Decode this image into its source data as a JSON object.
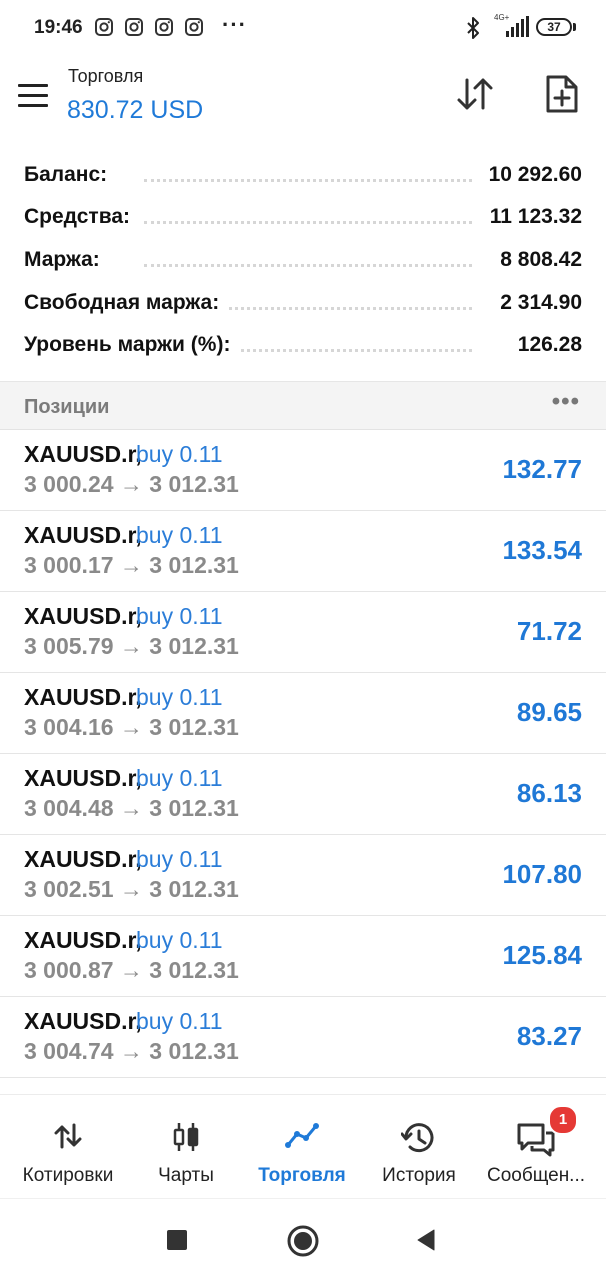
{
  "status_bar": {
    "time": "19:46",
    "notification_icons": [
      "instagram-icon",
      "instagram-icon",
      "instagram-icon",
      "instagram-icon"
    ],
    "more": "···",
    "network": "4G+",
    "battery": "37"
  },
  "header": {
    "title": "Торговля",
    "balance": "830.72 USD",
    "accent_color": "#1f7ad8"
  },
  "summary": [
    {
      "label": "Баланс:",
      "value": "10 292.60"
    },
    {
      "label": "Средства:",
      "value": "11 123.32"
    },
    {
      "label": "Маржа:",
      "value": "8 808.42"
    },
    {
      "label": "Свободная маржа:",
      "value": "2 314.90"
    },
    {
      "label": "Уровень маржи (%):",
      "value": "126.28"
    }
  ],
  "positions": {
    "title": "Позиции",
    "more": "•••",
    "items": [
      {
        "symbol": "XAUUSD.r,",
        "side": "buy 0.11",
        "prices": "3 000.24 → 3 012.31",
        "profit": "132.77"
      },
      {
        "symbol": "XAUUSD.r,",
        "side": "buy 0.11",
        "prices": "3 000.17 → 3 012.31",
        "profit": "133.54"
      },
      {
        "symbol": "XAUUSD.r,",
        "side": "buy 0.11",
        "prices": "3 005.79 → 3 012.31",
        "profit": "71.72"
      },
      {
        "symbol": "XAUUSD.r,",
        "side": "buy 0.11",
        "prices": "3 004.16 → 3 012.31",
        "profit": "89.65"
      },
      {
        "symbol": "XAUUSD.r,",
        "side": "buy 0.11",
        "prices": "3 004.48 → 3 012.31",
        "profit": "86.13"
      },
      {
        "symbol": "XAUUSD.r,",
        "side": "buy 0.11",
        "prices": "3 002.51 → 3 012.31",
        "profit": "107.80"
      },
      {
        "symbol": "XAUUSD.r,",
        "side": "buy 0.11",
        "prices": "3 000.87 → 3 012.31",
        "profit": "125.84"
      },
      {
        "symbol": "XAUUSD.r,",
        "side": "buy 0.11",
        "prices": "3 004.74 → 3 012.31",
        "profit": "83.27"
      }
    ]
  },
  "bottom_nav": {
    "items": [
      {
        "label": "Котировки",
        "icon": "quotes-icon"
      },
      {
        "label": "Чарты",
        "icon": "candlestick-chart-icon"
      },
      {
        "label": "Торговля",
        "icon": "trade-line-icon",
        "active": true
      },
      {
        "label": "История",
        "icon": "history-icon"
      },
      {
        "label": "Сообщен...",
        "icon": "messages-icon",
        "badge": "1"
      }
    ]
  },
  "system_nav": [
    "recents-square-icon",
    "home-circle-icon",
    "back-triangle-icon"
  ]
}
